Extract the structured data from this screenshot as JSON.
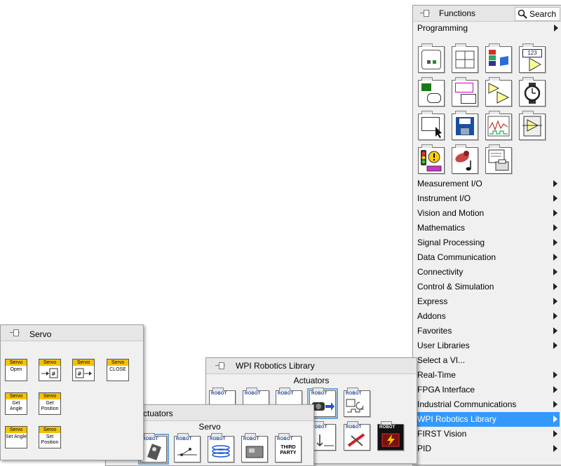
{
  "functions_palette": {
    "title": "Functions",
    "search_label": "Search",
    "programming_label": "Programming",
    "categories": [
      "Measurement I/O",
      "Instrument I/O",
      "Vision and Motion",
      "Mathematics",
      "Signal Processing",
      "Data Communication",
      "Connectivity",
      "Control & Simulation",
      "Express",
      "Addons",
      "Favorites",
      "User Libraries",
      "Select a VI...",
      "Real-Time",
      "FPGA Interface",
      "Industrial Communications",
      "WPI Robotics Library",
      "FIRST Vision",
      "PID"
    ],
    "selected_category": "WPI Robotics Library",
    "selection_color": "#3399ff"
  },
  "wpi_palette": {
    "title": "WPI Robotics Library",
    "section_label": "Actuators",
    "robot_tag": "ROBOT"
  },
  "actuators_palette": {
    "title_fragment": "ctuators",
    "section_label": "Servo",
    "third_party_label": "THIRD PARTY"
  },
  "servo_palette": {
    "title": "Servo",
    "header_tag": "Servo",
    "header_color": "#f5c200",
    "items": [
      {
        "label": "Open"
      },
      {
        "label": ""
      },
      {
        "label": ""
      },
      {
        "label": "CLOSE"
      },
      {
        "label": "Get Angle"
      },
      {
        "label": "Get Position"
      },
      {
        "label": "Set Angle"
      },
      {
        "label": "Set Position"
      }
    ]
  }
}
